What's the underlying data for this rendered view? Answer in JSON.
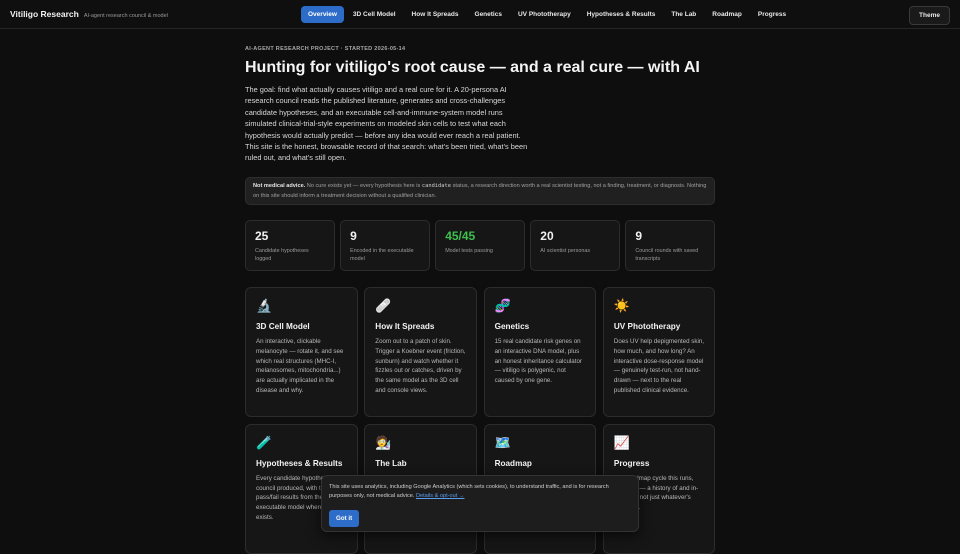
{
  "brand": {
    "title": "Vitiligo Research",
    "subtitle": "AI-agent research council & model"
  },
  "nav": [
    {
      "label": "Overview",
      "active": true
    },
    {
      "label": "3D Cell Model"
    },
    {
      "label": "How It Spreads"
    },
    {
      "label": "Genetics"
    },
    {
      "label": "UV Phototherapy"
    },
    {
      "label": "Hypotheses & Results"
    },
    {
      "label": "The Lab"
    },
    {
      "label": "Roadmap"
    },
    {
      "label": "Progress"
    }
  ],
  "theme_label": "Theme",
  "hero": {
    "kicker": "AI-AGENT RESEARCH PROJECT · STARTED 2026-05-14",
    "title": "Hunting for vitiligo's root cause — and a real cure — with AI",
    "intro": "The goal: find what actually causes vitiligo and a real cure for it. A 20-persona AI research council reads the published literature, generates and cross-challenges candidate hypotheses, and an executable cell-and-immune-system model runs simulated clinical-trial-style experiments on modeled skin cells to test what each hypothesis would actually predict — before any idea would ever reach a real patient. This site is the honest, browsable record of that search: what's been tried, what's been ruled out, and what's still open."
  },
  "notice": {
    "strong": "Not medical advice.",
    "before_code": " No cure exists yet — every hypothesis here is ",
    "code": "candidate",
    "after_code": " status, a research direction worth a real scientist testing, not a finding, treatment, or diagnosis. Nothing on this site should inform a treatment decision without a qualified clinician."
  },
  "stats": [
    {
      "value": "25",
      "label": "Candidate hypotheses logged"
    },
    {
      "value": "9",
      "label": "Encoded in the executable model"
    },
    {
      "value": "45/45",
      "label": "Model tests passing",
      "color": "#3fbf4f"
    },
    {
      "value": "20",
      "label": "AI scientist personas"
    },
    {
      "value": "9",
      "label": "Council rounds with saved transcripts"
    }
  ],
  "cards": [
    {
      "icon": "microscope-icon",
      "glyph": "🔬",
      "title": "3D Cell Model",
      "desc": "An interactive, clickable melanocyte — rotate it, and see which real structures (MHC-I, melanosomes, mitochondria...) are actually implicated in the disease and why."
    },
    {
      "icon": "bandage-icon",
      "glyph": "🩹",
      "title": "How It Spreads",
      "desc": "Zoom out to a patch of skin. Trigger a Koebner event (friction, sunburn) and watch whether it fizzles out or catches, driven by the same model as the 3D cell and console views."
    },
    {
      "icon": "dna-icon",
      "glyph": "🧬",
      "title": "Genetics",
      "desc": "15 real candidate risk genes on an interactive DNA model, plus an honest inheritance calculator — vitiligo is polygenic, not caused by one gene."
    },
    {
      "icon": "sun-icon",
      "glyph": "☀️",
      "title": "UV Phototherapy",
      "desc": "Does UV help depigmented skin, how much, and how long? An interactive dose-response model — genuinely test-run, not hand-drawn — next to the real published clinical evidence."
    },
    {
      "icon": "test-tube-icon",
      "glyph": "🧪",
      "title": "Hypotheses & Results",
      "desc": "Every candidate hypothesis the council produced, with the pass/fail results from the executable model where one exists."
    },
    {
      "icon": "scientist-icon",
      "glyph": "🧑‍🔬",
      "title": "The Lab",
      "desc": ""
    },
    {
      "icon": "map-icon",
      "glyph": "🗺️",
      "title": "Roadmap",
      "desc": ""
    },
    {
      "icon": "chart-icon",
      "glyph": "📈",
      "title": "Progress",
      "desc": "The roadmap cycle this runs, past and — a history of and in-progress not just whatever's right now."
    }
  ],
  "cookie": {
    "text": "This site uses analytics, including Google Analytics (which sets cookies), to understand traffic, and is for research purposes only, not medical advice. ",
    "link": "Details & opt-out →",
    "button": "Got it"
  }
}
